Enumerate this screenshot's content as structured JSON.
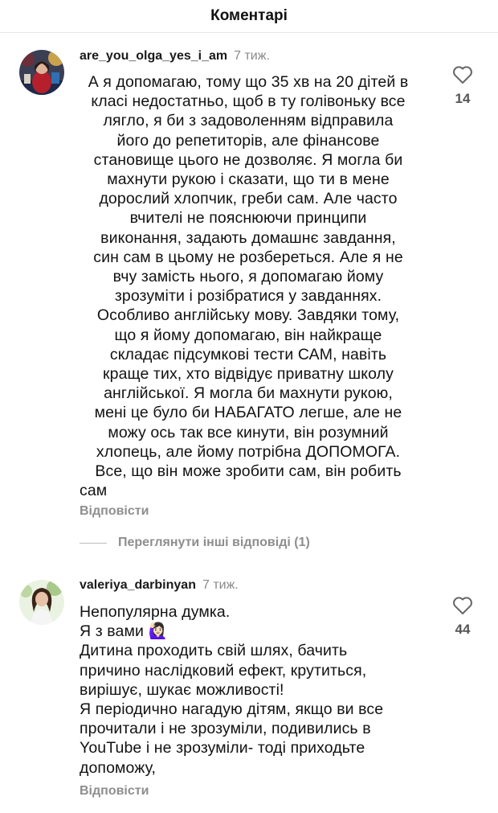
{
  "header": {
    "title": "Коментарі"
  },
  "comments": [
    {
      "username": "are_you_olga_yes_i_am",
      "ago": "7 тиж.",
      "likes": "14",
      "lines": [
        "А я допомагаю, тому що 35 хв на 20 дітей в",
        "класі недостатньо, щоб в ту голівоньку все",
        "лягло, я би з задоволенням відправила",
        "його до репетиторів, але фінансове",
        "становище цього не дозволяє. Я могла би",
        "махнути рукою і сказати, що ти в мене",
        "дорослий хлопчик, греби сам. Але часто",
        "вчителі не пояснюючи принципи",
        "виконання, задають домашнє завдання,",
        "син сам в цьому не розбереться. Але я не",
        "вчу замість нього, я допомагаю йому",
        "зрозуміти і розібратися у завданнях.",
        "Особливо англійську мову. Завдяки тому,",
        "що я йому допомагаю, він найкраще",
        "складає підсумкові тести САМ, навіть",
        "краще тих, хто відвідує приватну школу",
        "англійської. Я могла би махнути рукою,",
        "мені це було би НАБАГАТО легше, але не",
        "можу ось так все кинути, він розумний",
        "хлопець, але йому потрібна ДОПОМОГА.",
        "Все, що він може зробити сам, він робить",
        "сам"
      ],
      "reply_label": "Відповісти"
    },
    {
      "username": "valeriya_darbinyan",
      "ago": "7 тиж.",
      "likes": "44",
      "lines": [
        "Непопулярна думка.",
        "Я з вами 🙋🏻‍♀️",
        "Дитина проходить свій шлях, бачить",
        "причино наслідковий ефект, крутиться,",
        "вирішує, шукає можливості!",
        "Я періодично нагадую дітям, якщо ви все",
        "прочитали і не зрозуміли, подивились в",
        "YouTube і не зрозуміли- тоді приходьте",
        "допоможу,"
      ],
      "reply_label": "Відповісти"
    }
  ],
  "view_replies_label": "Переглянути інші відповіді (1)",
  "colors": {
    "muted": "#8e8e8e",
    "text": "#121212"
  }
}
